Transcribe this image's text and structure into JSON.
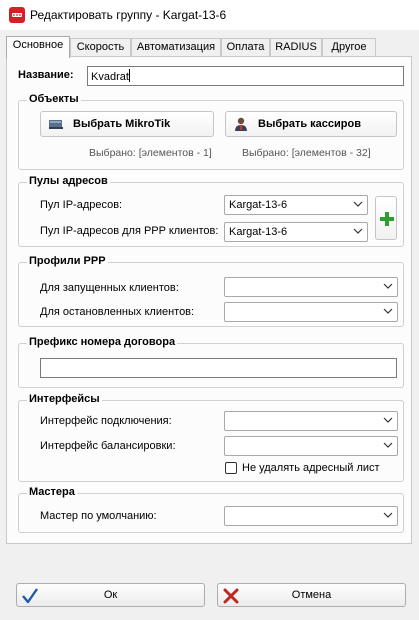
{
  "window": {
    "title": "Редактировать группу - Kargat-13-6"
  },
  "tabs": [
    {
      "label": "Основное"
    },
    {
      "label": "Скорость"
    },
    {
      "label": "Автоматизация"
    },
    {
      "label": "Оплата"
    },
    {
      "label": "RADIUS"
    },
    {
      "label": "Другое"
    }
  ],
  "name": {
    "label": "Название:",
    "value": "Kvadrat"
  },
  "objects": {
    "title": "Объекты",
    "mikrotik_button": "Выбрать MikroTik",
    "cashiers_button": "Выбрать кассиров",
    "mikrotik_selected": "Выбрано:  [элементов - 1]",
    "cashiers_selected": "Выбрано:  [элементов - 32]"
  },
  "pools": {
    "title": "Пулы адресов",
    "ip_pool_label": "Пул IP-адресов:",
    "ip_pool_value": "Kargat-13-6",
    "ppp_pool_label": "Пул IP-адресов для PPP клиентов:",
    "ppp_pool_value": "Kargat-13-6"
  },
  "ppp": {
    "title": "Профили PPP",
    "running_label": "Для запущенных клиентов:",
    "running_value": "",
    "stopped_label": "Для остановленных клиентов:",
    "stopped_value": ""
  },
  "prefix": {
    "title": "Префикс номера договора",
    "value": ""
  },
  "interfaces": {
    "title": "Интерфейсы",
    "connect_label": "Интерфейс подключения:",
    "connect_value": "",
    "balance_label": "Интерфейс балансировки:",
    "balance_value": "",
    "keep_list_label": "Не удалять адресный лист",
    "keep_list_checked": false
  },
  "wizards": {
    "title": "Мастера",
    "default_label": "Мастер по умолчанию:",
    "default_value": ""
  },
  "buttons": {
    "ok": "Ок",
    "cancel": "Отмена"
  },
  "colors": {
    "accent_red": "#d32027",
    "add_green": "#2e9e2e",
    "ok_blue": "#1e5aa8",
    "cancel_red": "#c0281e"
  }
}
